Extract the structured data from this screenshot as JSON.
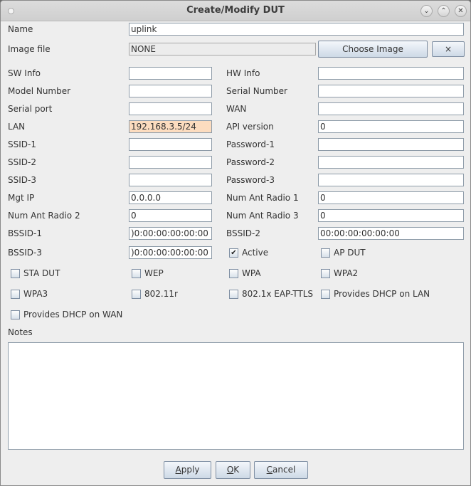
{
  "window": {
    "title": "Create/Modify DUT",
    "controls": {
      "minimize": "⌄",
      "maximize": "⌃",
      "close": "✕"
    }
  },
  "form": {
    "name": {
      "label": "Name",
      "value": "uplink"
    },
    "image_file": {
      "label": "Image file",
      "value": "NONE",
      "choose_label": "Choose Image",
      "clear_label": "×"
    },
    "sw_info": {
      "label": "SW Info",
      "value": ""
    },
    "hw_info": {
      "label": "HW Info",
      "value": ""
    },
    "model_number": {
      "label": "Model Number",
      "value": ""
    },
    "serial_number": {
      "label": "Serial Number",
      "value": ""
    },
    "serial_port": {
      "label": "Serial port",
      "value": ""
    },
    "wan": {
      "label": "WAN",
      "value": ""
    },
    "lan": {
      "label": "LAN",
      "value": "192.168.3.5/24"
    },
    "api_version": {
      "label": "API version",
      "value": "0"
    },
    "ssid1": {
      "label": "SSID-1",
      "value": ""
    },
    "password1": {
      "label": "Password-1",
      "value": ""
    },
    "ssid2": {
      "label": "SSID-2",
      "value": ""
    },
    "password2": {
      "label": "Password-2",
      "value": ""
    },
    "ssid3": {
      "label": "SSID-3",
      "value": ""
    },
    "password3": {
      "label": "Password-3",
      "value": ""
    },
    "mgt_ip": {
      "label": "Mgt IP",
      "value": "0.0.0.0"
    },
    "num_ant_radio1": {
      "label": "Num Ant Radio 1",
      "value": "0"
    },
    "num_ant_radio2": {
      "label": "Num Ant Radio 2",
      "value": "0"
    },
    "num_ant_radio3": {
      "label": "Num Ant Radio 3",
      "value": "0"
    },
    "bssid1": {
      "label": "BSSID-1",
      "value": ")0:00:00:00:00:00"
    },
    "bssid2": {
      "label": "BSSID-2",
      "value": "00:00:00:00:00:00"
    },
    "bssid3": {
      "label": "BSSID-3",
      "value": ")0:00:00:00:00:00"
    }
  },
  "checkboxes": {
    "active": {
      "label": "Active",
      "checked": true,
      "mark": "✔"
    },
    "ap_dut": {
      "label": "AP DUT",
      "checked": false
    },
    "sta_dut": {
      "label": "STA DUT",
      "checked": false
    },
    "wep": {
      "label": "WEP",
      "checked": false
    },
    "wpa": {
      "label": "WPA",
      "checked": false
    },
    "wpa2": {
      "label": "WPA2",
      "checked": false
    },
    "wpa3": {
      "label": "WPA3",
      "checked": false
    },
    "r80211": {
      "label": "802.11r",
      "checked": false
    },
    "eap_ttls": {
      "label": "802.1x EAP-TTLS",
      "checked": false
    },
    "dhcp_lan": {
      "label": "Provides DHCP on LAN",
      "checked": false
    },
    "dhcp_wan": {
      "label": "Provides DHCP on WAN",
      "checked": false
    }
  },
  "notes": {
    "label": "Notes",
    "value": ""
  },
  "buttons": {
    "apply": {
      "mnemonic": "A",
      "rest": "pply"
    },
    "ok": {
      "mnemonic": "O",
      "rest": "K"
    },
    "cancel": {
      "mnemonic": "C",
      "rest": "ancel"
    }
  }
}
